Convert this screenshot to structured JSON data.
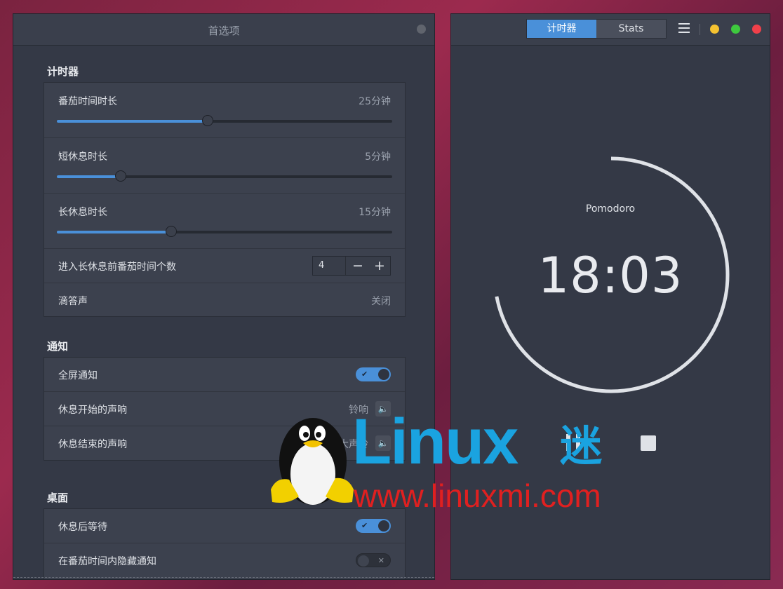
{
  "prefs": {
    "title": "首选项",
    "timer_section": {
      "title": "计时器",
      "pomodoro": {
        "label": "番茄时间时长",
        "value": "25分钟",
        "fraction": 0.45
      },
      "short_break": {
        "label": "短休息时长",
        "value": "5分钟",
        "fraction": 0.19
      },
      "long_break": {
        "label": "长休息时长",
        "value": "15分钟",
        "fraction": 0.34
      },
      "count": {
        "label": "进入长休息前番茄时间个数",
        "value": "4",
        "minus": "−",
        "plus": "+"
      },
      "tick": {
        "label": "滴答声",
        "value": "关闭"
      }
    },
    "notify_section": {
      "title": "通知",
      "fullscreen": {
        "label": "全屏通知",
        "on": true
      },
      "break_start": {
        "label": "休息开始的声响",
        "value": "铃响"
      },
      "break_end": {
        "label": "休息结束的声响",
        "value": "大声铃"
      }
    },
    "desktop_section": {
      "title": "桌面",
      "wait_after_break": {
        "label": "休息后等待",
        "on": true
      },
      "hide_notifications": {
        "label": "在番茄时间内隐藏通知",
        "on": false
      }
    }
  },
  "timer": {
    "tabs": [
      "计时器",
      "Stats"
    ],
    "active_tab": 0,
    "name": "Pomodoro",
    "time": "18:03",
    "progress": 0.72
  },
  "toggle_marks": {
    "on": "✔",
    "off": "✕"
  },
  "watermark": {
    "brand": "Linux",
    "brand_cn": "迷",
    "url": "www.linuxmi.com"
  },
  "colors": {
    "accent": "#4a90d9",
    "minimize": "#f5c231",
    "maximize": "#3ec93e",
    "close": "#f0404a"
  }
}
